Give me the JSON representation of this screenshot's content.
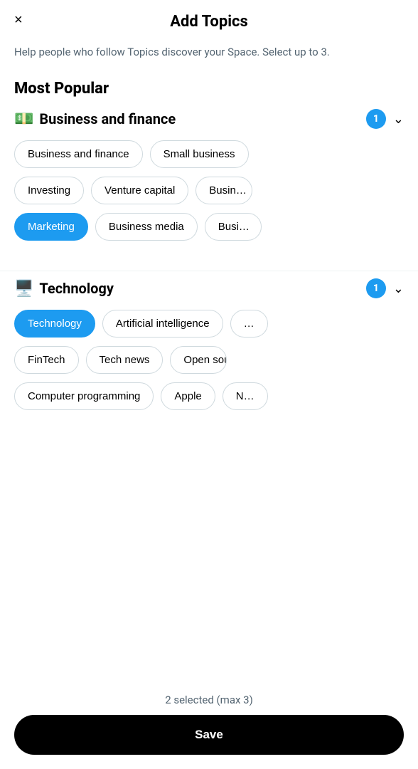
{
  "header": {
    "title": "Add Topics",
    "close_icon": "×"
  },
  "subtitle": "Help people who follow Topics discover your Space. Select up to 3.",
  "most_popular_label": "Most Popular",
  "sections": [
    {
      "id": "business-finance",
      "icon": "💵",
      "title": "Business and finance",
      "count": 1,
      "rows": [
        [
          {
            "label": "Business and finance",
            "selected": false
          },
          {
            "label": "Small business",
            "selected": false
          }
        ],
        [
          {
            "label": "Investing",
            "selected": false
          },
          {
            "label": "Venture capital",
            "selected": false
          },
          {
            "label": "Busin…",
            "selected": false,
            "partial": true
          }
        ],
        [
          {
            "label": "Marketing",
            "selected": true
          },
          {
            "label": "Business media",
            "selected": false
          },
          {
            "label": "Busi…",
            "selected": false,
            "partial": true
          }
        ]
      ]
    },
    {
      "id": "technology",
      "icon": "🖥️",
      "title": "Technology",
      "count": 1,
      "rows": [
        [
          {
            "label": "Technology",
            "selected": true
          },
          {
            "label": "Artificial intelligence",
            "selected": false
          },
          {
            "label": "…",
            "selected": false,
            "partial": true
          }
        ],
        [
          {
            "label": "FinTech",
            "selected": false
          },
          {
            "label": "Tech news",
            "selected": false
          },
          {
            "label": "Open source",
            "selected": false,
            "partial": true
          }
        ],
        [
          {
            "label": "Computer programming",
            "selected": false
          },
          {
            "label": "Apple",
            "selected": false
          },
          {
            "label": "N…",
            "selected": false,
            "partial": true
          }
        ]
      ]
    }
  ],
  "bottom": {
    "selected_text": "2 selected (max 3)",
    "save_label": "Save"
  }
}
